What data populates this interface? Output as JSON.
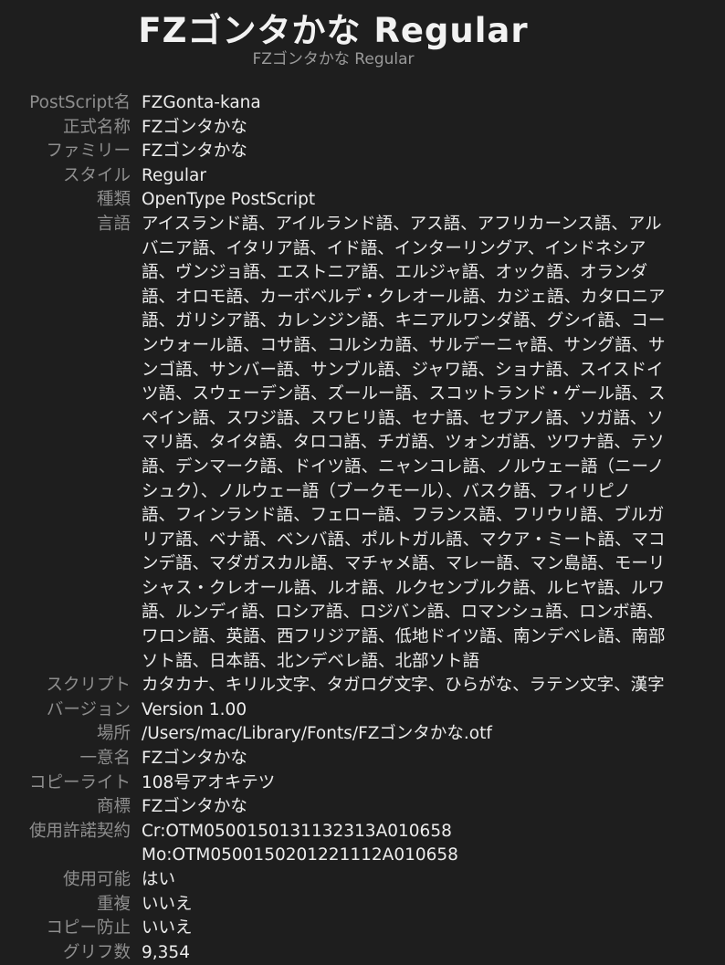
{
  "preview": {
    "sample": "FZゴンタかな Regular",
    "caption": "FZゴンタかな Regular"
  },
  "fields": {
    "postscript_name": {
      "label": "PostScript名",
      "value": "FZGonta-kana"
    },
    "full_name": {
      "label": "正式名称",
      "value": "FZゴンタかな"
    },
    "family": {
      "label": "ファミリー",
      "value": "FZゴンタかな"
    },
    "style": {
      "label": "スタイル",
      "value": "Regular"
    },
    "kind": {
      "label": "種類",
      "value": "OpenType PostScript"
    },
    "languages": {
      "label": "言語",
      "lines": [
        "アイスランド語、アイルランド語、アス語、アフリカーンス語、アル",
        "バニア語、イタリア語、イド語、インターリングア、インドネシア",
        "語、ヴンジョ語、エストニア語、エルジャ語、オック語、オランダ",
        "語、オロモ語、カーボベルデ・クレオール語、カジェ語、カタロニア",
        "語、ガリシア語、カレンジン語、キニアルワンダ語、グシイ語、コー",
        "ンウォール語、コサ語、コルシカ語、サルデーニャ語、サング語、サ",
        "ンゴ語、サンバー語、サンブル語、ジャワ語、ショナ語、スイスドイ",
        "ツ語、スウェーデン語、ズールー語、スコットランド・ゲール語、ス",
        "ペイン語、スワジ語、スワヒリ語、セナ語、セブアノ語、ソガ語、ソ",
        "マリ語、タイタ語、タロコ語、チガ語、ツォンガ語、ツワナ語、テソ",
        "語、デンマーク語、ドイツ語、ニャンコレ語、ノルウェー語（ニーノ",
        "シュク）、ノルウェー語（ブークモール）、バスク語、フィリピノ",
        "語、フィンランド語、フェロー語、フランス語、フリウリ語、ブルガ",
        "リア語、ベナ語、ベンバ語、ポルトガル語、マクア・ミート語、マコ",
        "ンデ語、マダガスカル語、マチャメ語、マレー語、マン島語、モーリ",
        "シャス・クレオール語、ルオ語、ルクセンブルク語、ルヒヤ語、ルワ",
        "語、ルンディ語、ロシア語、ロジバン語、ロマンシュ語、ロンボ語、",
        "ワロン語、英語、西フリジア語、低地ドイツ語、南ンデベレ語、南部",
        "ソト語、日本語、北ンデベレ語、北部ソト語"
      ]
    },
    "script": {
      "label": "スクリプト",
      "value": "カタカナ、キリル文字、タガログ文字、ひらがな、ラテン文字、漢字"
    },
    "version": {
      "label": "バージョン",
      "value": "Version 1.00"
    },
    "location": {
      "label": "場所",
      "value": "/Users/mac/Library/Fonts/FZゴンタかな.otf"
    },
    "unique_name": {
      "label": "一意名",
      "value": "FZゴンタかな"
    },
    "copyright": {
      "label": "コピーライト",
      "value": "108号アオキテツ"
    },
    "trademark": {
      "label": "商標",
      "value": "FZゴンタかな"
    },
    "license": {
      "label": "使用許諾契約",
      "lines": [
        "Cr:OTM0500150131132313A010658",
        "Mo:OTM0500150201221112A010658"
      ]
    },
    "enabled": {
      "label": "使用可能",
      "value": "はい"
    },
    "duplicate": {
      "label": "重複",
      "value": "いいえ"
    },
    "copy_protected": {
      "label": "コピー防止",
      "value": "いいえ"
    },
    "glyph_count": {
      "label": "グリフ数",
      "value": "9,354"
    }
  }
}
